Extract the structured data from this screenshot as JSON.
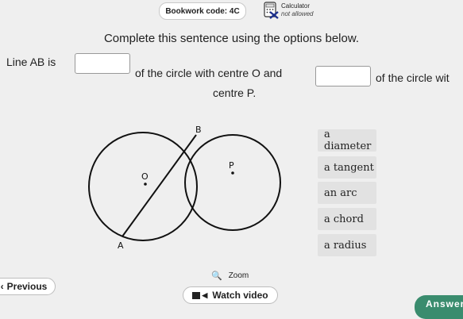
{
  "header": {
    "bookwork_label": "Bookwork code: 4C",
    "calculator_label": "Calculator",
    "calculator_status": "not allowed"
  },
  "question": {
    "prompt": "Complete this sentence using the options below.",
    "part1": "Line AB is",
    "part2": "of the circle with centre O and",
    "part3": "of the circle wit",
    "part4": "centre P."
  },
  "diagram": {
    "labels": {
      "B": "B",
      "O": "O",
      "P": "P",
      "A": "A"
    }
  },
  "options": [
    "a diameter",
    "a tangent",
    "an arc",
    "a chord",
    "a radius"
  ],
  "footer": {
    "zoom_label": "Zoom",
    "previous_label": "Previous",
    "watch_video_label": "Watch video",
    "answer_label": "Answer"
  },
  "colors": {
    "accent": "#3a8c6e",
    "calculator_cross": "#1b2f8c"
  }
}
